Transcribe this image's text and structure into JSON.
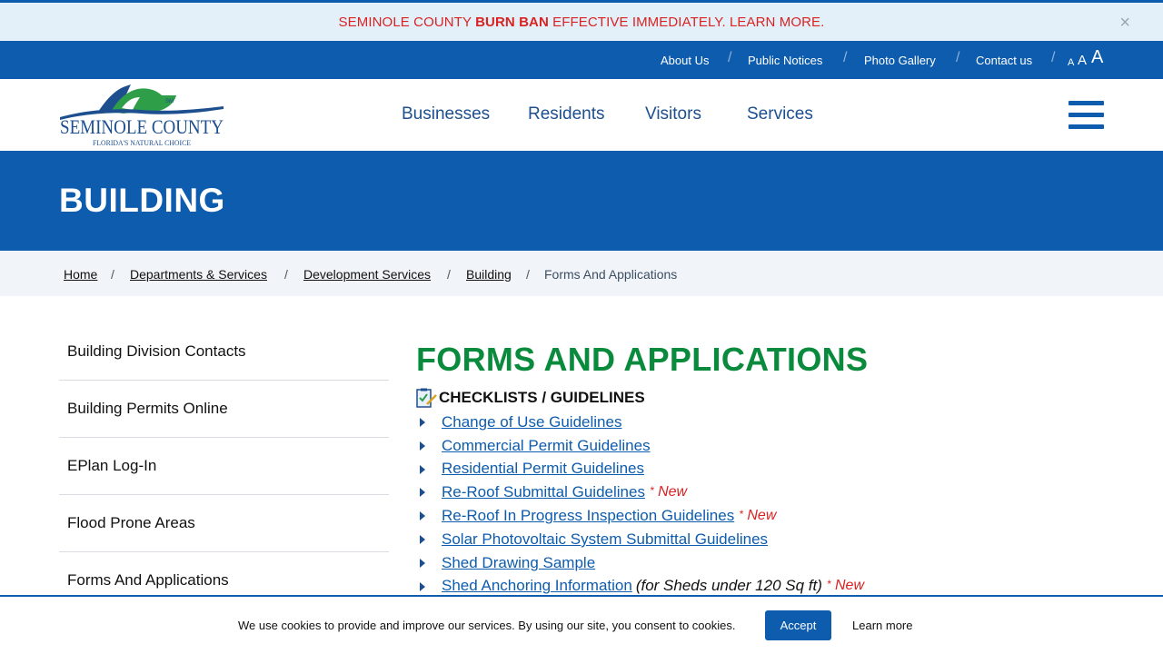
{
  "alert": {
    "text_before": "SEMINOLE COUNTY ",
    "text_bold": "BURN BAN",
    "text_after": " EFFECTIVE IMMEDIATELY. LEARN MORE.",
    "close_symbol": "×"
  },
  "utility_nav": {
    "items": [
      "About Us",
      "Public Notices",
      "Photo Gallery",
      "Contact us"
    ],
    "separator": "/",
    "font_sizes": [
      "A",
      "A",
      "A"
    ]
  },
  "logo": {
    "name": "SEMINOLE COUNTY",
    "tagline": "FLORIDA'S NATURAL CHOICE",
    "mark": "SM"
  },
  "main_nav": {
    "items": [
      "Businesses",
      "Residents",
      "Visitors",
      "Services"
    ]
  },
  "hero": {
    "title": "BUILDING"
  },
  "breadcrumbs": {
    "items": [
      "Home",
      "Departments & Services",
      "Development Services",
      "Building",
      "Forms And Applications"
    ],
    "separator": "/"
  },
  "sidebar": {
    "items": [
      "Building Division Contacts",
      "Building Permits Online",
      "EPlan Log-In",
      "Flood Prone Areas",
      "Forms And Applications"
    ]
  },
  "content": {
    "heading": "FORMS AND APPLICATIONS",
    "section_title": "CHECKLISTS / GUIDELINES",
    "links": [
      {
        "label": "Change of Use Guidelines",
        "note": "",
        "badge": ""
      },
      {
        "label": "Commercial Permit Guidelines",
        "note": "",
        "badge": ""
      },
      {
        "label": "Residential Permit Guidelines",
        "note": "",
        "badge": ""
      },
      {
        "label": "Re-Roof Submittal Guidelines",
        "note": "",
        "badge": "New"
      },
      {
        "label": "Re-Roof In Progress Inspection Guidelines",
        "note": "",
        "badge": "New"
      },
      {
        "label": "Solar Photovoltaic System Submittal Guidelines",
        "note": "",
        "badge": ""
      },
      {
        "label": "Shed Drawing Sample",
        "note": "",
        "badge": ""
      },
      {
        "label": "Shed Anchoring Information",
        "note": "(for Sheds under 120 Sq ft)",
        "badge": "New"
      }
    ],
    "badge_star": "*"
  },
  "cookie": {
    "text": "We use cookies to provide and improve our services. By using our site, you consent to cookies.",
    "accept_label": "Accept",
    "learn_more_label": "Learn more"
  },
  "colors": {
    "brand_blue": "#0e5cad",
    "heading_green": "#0a8a3c",
    "alert_red": "#d92323"
  }
}
